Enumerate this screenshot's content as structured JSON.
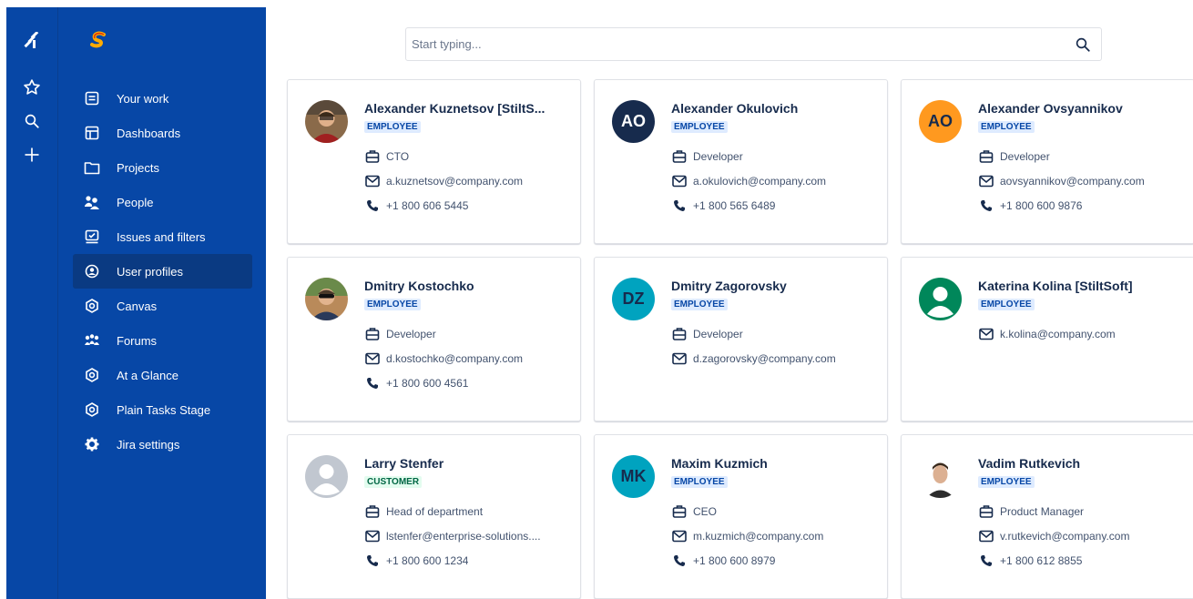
{
  "search": {
    "placeholder": "Start typing..."
  },
  "sidebar": {
    "items": [
      {
        "label": "Your work",
        "icon": "your-work-icon"
      },
      {
        "label": "Dashboards",
        "icon": "dashboards-icon"
      },
      {
        "label": "Projects",
        "icon": "projects-icon"
      },
      {
        "label": "People",
        "icon": "people-icon"
      },
      {
        "label": "Issues and filters",
        "icon": "issues-icon"
      },
      {
        "label": "User profiles",
        "icon": "user-profiles-icon",
        "active": true
      },
      {
        "label": "Canvas",
        "icon": "canvas-icon"
      },
      {
        "label": "Forums",
        "icon": "forums-icon"
      },
      {
        "label": "At a Glance",
        "icon": "at-a-glance-icon"
      },
      {
        "label": "Plain Tasks Stage",
        "icon": "plain-tasks-icon"
      },
      {
        "label": "Jira settings",
        "icon": "settings-icon"
      }
    ]
  },
  "colors": {
    "sidebar_bg": "#0747A6",
    "active_bg": "#0A3A82",
    "badge_employee_bg": "#DEEBFF",
    "badge_customer_bg": "#E3FCEF",
    "avatar_ao_navy": "#172B4D",
    "avatar_ao_orange": "#FF991F",
    "avatar_teal": "#00A3BF",
    "avatar_green": "#00875A"
  },
  "users": [
    {
      "name": "Alexander Kuznetsov [StiltS...",
      "badge": "EMPLOYEE",
      "title": "CTO",
      "email": "a.kuznetsov@company.com",
      "phone": "+1 800 606 5445",
      "avatar": "photo"
    },
    {
      "name": "Alexander Okulovich",
      "badge": "EMPLOYEE",
      "title": "Developer",
      "email": "a.okulovich@company.com",
      "phone": "+1 800 565 6489",
      "avatar": "AO"
    },
    {
      "name": "Alexander Ovsyannikov",
      "badge": "EMPLOYEE",
      "title": "Developer",
      "email": "aovsyannikov@company.com",
      "phone": "+1 800 600 9876",
      "avatar": "AO"
    },
    {
      "name": "Dmitry Kostochko",
      "badge": "EMPLOYEE",
      "title": "Developer",
      "email": "d.kostochko@company.com",
      "phone": "+1 800 600 4561",
      "avatar": "photo"
    },
    {
      "name": "Dmitry Zagorovsky",
      "badge": "EMPLOYEE",
      "title": "Developer",
      "email": "d.zagorovsky@company.com",
      "phone": "",
      "avatar": "DZ"
    },
    {
      "name": "Katerina Kolina [StiltSoft]",
      "badge": "EMPLOYEE",
      "title": "",
      "email": "k.kolina@company.com",
      "phone": "",
      "avatar": "default-green"
    },
    {
      "name": "Larry Stenfer",
      "badge": "CUSTOMER",
      "title": "Head of department",
      "email": "lstenfer@enterprise-solutions....",
      "phone": "+1 800 600 1234",
      "avatar": "default-grey"
    },
    {
      "name": "Maxim Kuzmich",
      "badge": "EMPLOYEE",
      "title": "CEO",
      "email": "m.kuzmich@company.com",
      "phone": "+1 800 600 8979",
      "avatar": "MK"
    },
    {
      "name": "Vadim Rutkevich",
      "badge": "EMPLOYEE",
      "title": "Product Manager",
      "email": "v.rutkevich@company.com",
      "phone": "+1 800 612 8855",
      "avatar": "photo"
    }
  ]
}
